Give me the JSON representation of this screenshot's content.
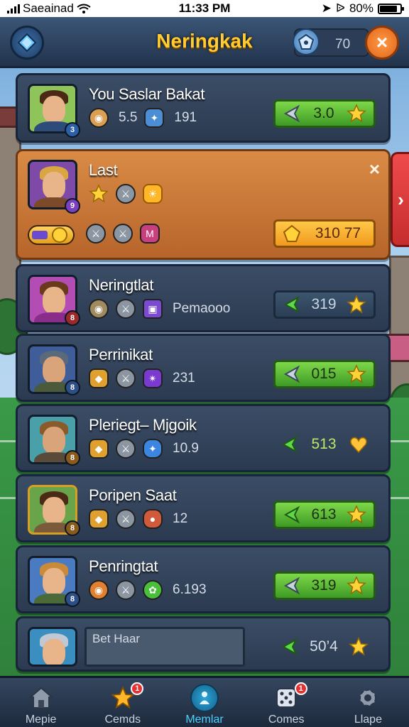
{
  "status_bar": {
    "carrier": "Saeainad",
    "time": "11:33 PM",
    "battery": "80%"
  },
  "header": {
    "title": "Neringkak",
    "currency_value": "70",
    "close_label": "×"
  },
  "players": [
    {
      "name": "You Saslar Bakat",
      "stat_value": "191",
      "stat_small": "5.5",
      "level": "3",
      "score": "3.0",
      "button_style": "green",
      "avatar_bg": "#9fc95a"
    },
    {
      "name": "Last",
      "level": "9",
      "score": "310 77",
      "button_style": "orange",
      "avatar_bg": "#7d4aa8",
      "dismiss_label": "×"
    },
    {
      "name": "Neringtlat",
      "stat_value": "Pemaooo",
      "level": "8",
      "score": "319",
      "button_style": "dark",
      "avatar_bg": "#b34db3"
    },
    {
      "name": "Perrinikat",
      "stat_value": "231",
      "level": "8",
      "score": "015",
      "button_style": "green",
      "avatar_bg": "#3f5d99"
    },
    {
      "name": "Pleriegt– Mjgoik",
      "stat_value": "10.9",
      "level": "8",
      "score": "513",
      "button_style": "plain",
      "avatar_bg": "#4aa0a8"
    },
    {
      "name": "Poripen Saat",
      "stat_value": "12",
      "level": "8",
      "score": "613",
      "button_style": "green",
      "avatar_bg": "#6aa44a"
    },
    {
      "name": "Penringtat",
      "stat_value": "6.193",
      "level": "8",
      "score": "319",
      "button_style": "green",
      "avatar_bg": "#4a7ac0"
    },
    {
      "name": "Bet Haar",
      "level": "",
      "score": "50’4",
      "button_style": "plain",
      "avatar_bg": "#3a8fc0"
    }
  ],
  "side_tab_label": "›",
  "nav": [
    {
      "label": "Mepie",
      "icon": "home-icon",
      "badge": ""
    },
    {
      "label": "Cemds",
      "icon": "star-icon",
      "badge": "1"
    },
    {
      "label": "Memlar",
      "icon": "member-icon",
      "badge": ""
    },
    {
      "label": "Comes",
      "icon": "dice-icon",
      "badge": "1"
    },
    {
      "label": "Llape",
      "icon": "gear-icon",
      "badge": ""
    }
  ],
  "colors": {
    "title_gold": "#ffcc33",
    "score_green": "#7fd84a",
    "active_card": "#d98b45",
    "nav_active": "#4fd0ff"
  }
}
